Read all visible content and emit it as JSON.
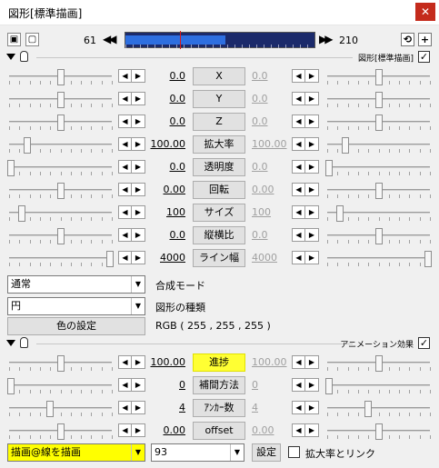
{
  "window": {
    "title": "図形[標準描画]",
    "close_label": "✕"
  },
  "toolbar": {
    "frame_start": "61",
    "frame_end": "210",
    "prev_label": "◀◀",
    "next_label": "▶▶",
    "add_label": "+",
    "timeline_progress": 0.53,
    "timeline_cursor": 0.29
  },
  "sections": {
    "figure": {
      "title": "図形[標準描画]",
      "checked": "✓"
    },
    "animation": {
      "title": "アニメーション効果",
      "checked": "✓"
    }
  },
  "params": [
    {
      "label": "X",
      "start": "0.0",
      "end": "0.0",
      "end_dim": true,
      "left_pos": 0.5,
      "right_pos": 0.5
    },
    {
      "label": "Y",
      "start": "0.0",
      "end": "0.0",
      "end_dim": true,
      "left_pos": 0.5,
      "right_pos": 0.5
    },
    {
      "label": "Z",
      "start": "0.0",
      "end": "0.0",
      "end_dim": true,
      "left_pos": 0.5,
      "right_pos": 0.5
    },
    {
      "label": "拡大率",
      "start": "100.00",
      "end": "100.00",
      "end_dim": true,
      "left_pos": 0.18,
      "right_pos": 0.18
    },
    {
      "label": "透明度",
      "start": "0.0",
      "end": "0.0",
      "end_dim": true,
      "left_pos": 0.02,
      "right_pos": 0.02
    },
    {
      "label": "回転",
      "start": "0.00",
      "end": "0.00",
      "end_dim": true,
      "left_pos": 0.5,
      "right_pos": 0.5
    },
    {
      "label": "サイズ",
      "start": "100",
      "end": "100",
      "end_dim": true,
      "left_pos": 0.12,
      "right_pos": 0.12
    },
    {
      "label": "縦横比",
      "start": "0.0",
      "end": "0.0",
      "end_dim": true,
      "left_pos": 0.5,
      "right_pos": 0.5
    },
    {
      "label": "ライン幅",
      "start": "4000",
      "end": "4000",
      "end_dim": true,
      "left_pos": 0.98,
      "right_pos": 0.98
    }
  ],
  "blend_mode": {
    "value": "通常",
    "label": "合成モード"
  },
  "shape_type": {
    "value": "円",
    "label": "図形の種類"
  },
  "color": {
    "button_label": "色の設定",
    "rgb_text": "RGB ( 255 , 255 , 255 )"
  },
  "anim_params": [
    {
      "label": "進捗",
      "start": "100.00",
      "end": "100.00",
      "end_dim": true,
      "highlight": true,
      "left_pos": 0.5,
      "right_pos": 0.5
    },
    {
      "label": "補間方法",
      "start": "0",
      "end": "0",
      "end_dim": true,
      "highlight": false,
      "left_pos": 0.02,
      "right_pos": 0.02
    },
    {
      "label": "ｱﾝｶｰ数",
      "start": "4",
      "end": "4",
      "end_dim": true,
      "highlight": false,
      "left_pos": 0.4,
      "right_pos": 0.4
    },
    {
      "label": "offset",
      "start": "0.00",
      "end": "0.00",
      "end_dim": true,
      "highlight": false,
      "left_pos": 0.5,
      "right_pos": 0.5
    }
  ],
  "bottom": {
    "effect_select": "描画@線を描画",
    "number_select": "93",
    "settings_button": "設定",
    "link_label": "拡大率とリンク"
  }
}
